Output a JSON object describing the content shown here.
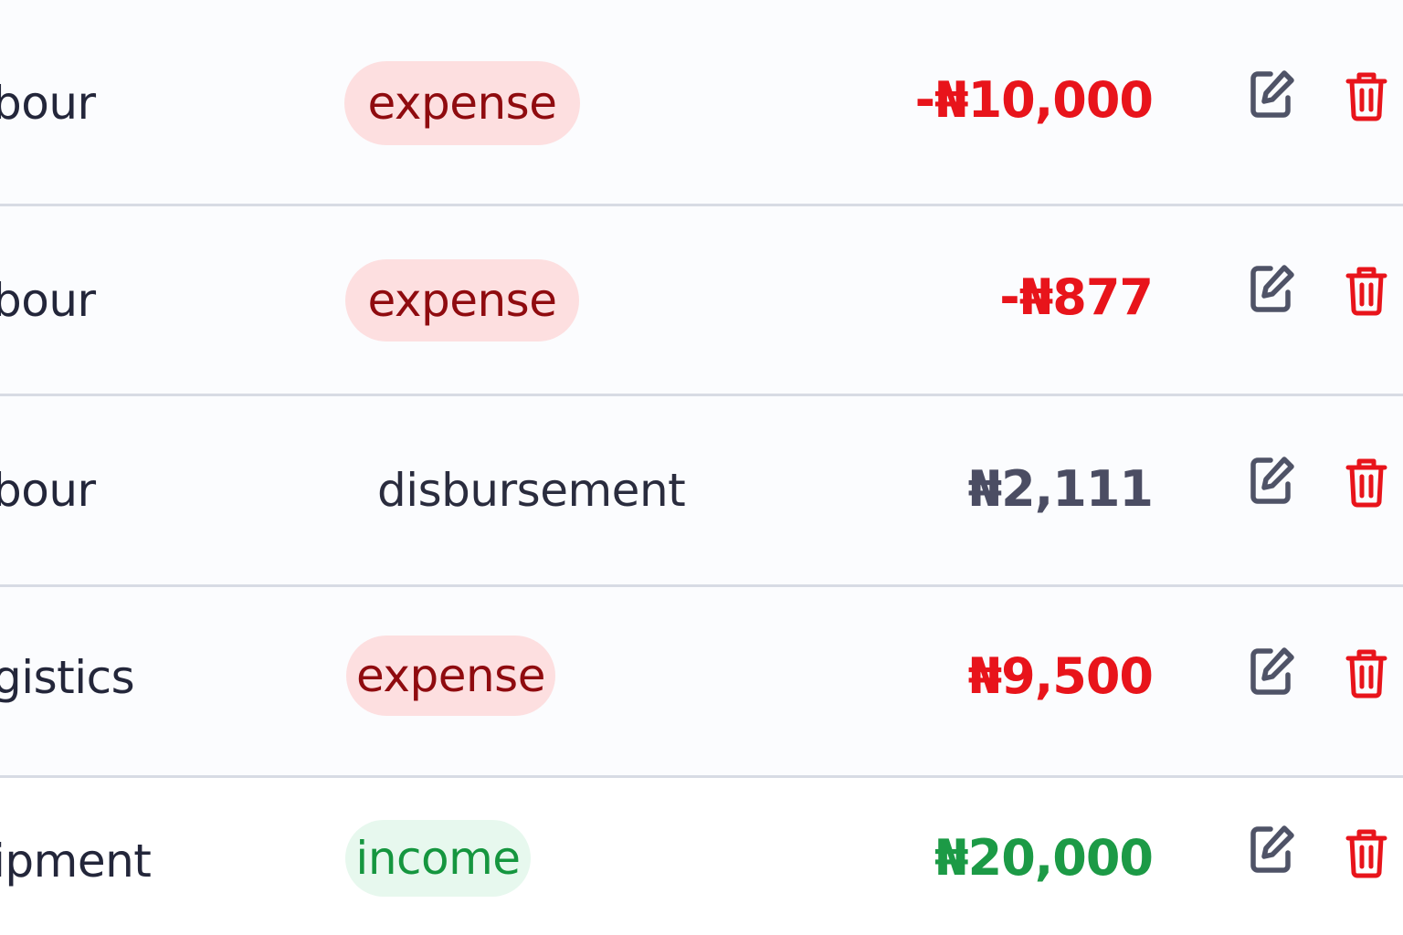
{
  "colors": {
    "expense_badge_bg": "#fddfe0",
    "expense_badge_text": "#8f0b0f",
    "income_badge_bg": "#e7f8ee",
    "income_badge_text": "#15963f",
    "negative_amount": "#e8141b",
    "neutral_amount": "#4b4d63",
    "positive_amount": "#1c9a46",
    "edit_icon": "#4f5367",
    "delete_icon": "#e8141b"
  },
  "rows": [
    {
      "category": "bour",
      "type": "expense",
      "type_style": "expense",
      "amount": "-₦10,000",
      "amount_style": "negative",
      "edit_icon": "edit-icon",
      "delete_icon": "trash-icon"
    },
    {
      "category": "bour",
      "type": "expense",
      "type_style": "expense",
      "amount": "-₦877",
      "amount_style": "negative",
      "edit_icon": "edit-icon",
      "delete_icon": "trash-icon"
    },
    {
      "category": "bour",
      "type": "disbursement",
      "type_style": "plain",
      "amount": "₦2,111",
      "amount_style": "neutral",
      "edit_icon": "edit-icon",
      "delete_icon": "trash-icon"
    },
    {
      "category": "gistics",
      "type": "expense",
      "type_style": "expense",
      "amount": "₦9,500",
      "amount_style": "negative",
      "edit_icon": "edit-icon",
      "delete_icon": "trash-icon"
    },
    {
      "category": "ipment",
      "type": "income",
      "type_style": "income",
      "amount": "₦20,000",
      "amount_style": "positive",
      "edit_icon": "edit-icon",
      "delete_icon": "trash-icon"
    }
  ]
}
